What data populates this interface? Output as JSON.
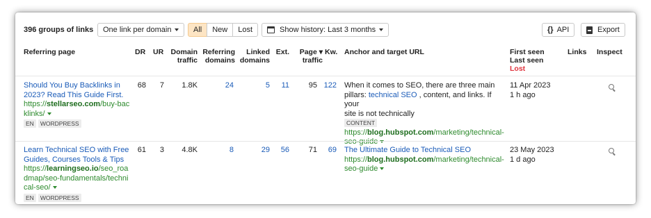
{
  "toolbar": {
    "groups_label": "396 groups of links",
    "mode_select": "One link per domain",
    "filter_all": "All",
    "filter_new": "New",
    "filter_lost": "Lost",
    "history_label": "Show history: Last 3 months",
    "api_label": "API",
    "export_label": "Export",
    "accent_color": "#fde5c4"
  },
  "columns": {
    "referring_page": "Referring page",
    "dr": "DR",
    "ur": "UR",
    "domain_traffic_1": "Domain",
    "domain_traffic_2": "traffic",
    "referring_domains_1": "Referring",
    "referring_domains_2": "domains",
    "linked_domains_1": "Linked",
    "linked_domains_2": "domains",
    "ext": "Ext.",
    "page_traffic_1": "Page ▾",
    "page_traffic_2": "traffic",
    "kw": "Kw.",
    "anchor": "Anchor and target URL",
    "first_seen": "First seen",
    "last_seen": "Last seen",
    "lost": "Lost",
    "links": "Links",
    "inspect": "Inspect"
  },
  "rows": [
    {
      "title_1": "Should You Buy Backlinks in",
      "title_2": "2023? Read This Guide First.",
      "url_pre": "https://",
      "url_domain": "stellarseo.com",
      "url_post_1": "/buy-bac",
      "url_post_2": "klinks/",
      "tag_lang": "EN",
      "tag_cms": "WORDPRESS",
      "dr": "68",
      "ur": "7",
      "domain_traffic": "1.8K",
      "referring_domains": "24",
      "linked_domains": "5",
      "ext": "11",
      "page_traffic": "95",
      "kw": "122",
      "anchor_text_1": "When it comes to SEO, there are three main",
      "anchor_text_2a": "pillars: ",
      "anchor_link": "technical SEO",
      "anchor_text_2b": " , content, and links. If your",
      "anchor_text_3": "site is not technically",
      "anchor_tag": "CONTENT",
      "target_pre": "https://",
      "target_domain": "blog.hubspot.com",
      "target_post_1": "/marketing/technical-",
      "target_post_2": "seo-guide",
      "first_seen": "11 Apr 2023",
      "last_seen": "1 h ago"
    },
    {
      "title_1": "Learn Technical SEO with Free",
      "title_2": "Guides, Courses Tools & Tips",
      "url_pre": "https://",
      "url_domain": "learningseo.io",
      "url_post_1": "/seo_roa",
      "url_post_2": "dmap/seo-fundamentals/techni",
      "url_post_3": "cal-seo/",
      "tag_lang": "EN",
      "tag_cms": "WORDPRESS",
      "dr": "61",
      "ur": "3",
      "domain_traffic": "4.8K",
      "referring_domains": "8",
      "linked_domains": "29",
      "ext": "56",
      "page_traffic": "71",
      "kw": "69",
      "anchor_link": "The Ultimate Guide to Technical SEO",
      "target_pre": "https://",
      "target_domain": "blog.hubspot.com",
      "target_post_1": "/marketing/technical-",
      "target_post_2": "seo-guide",
      "first_seen": "23 May 2023",
      "last_seen": "1 d ago"
    }
  ]
}
